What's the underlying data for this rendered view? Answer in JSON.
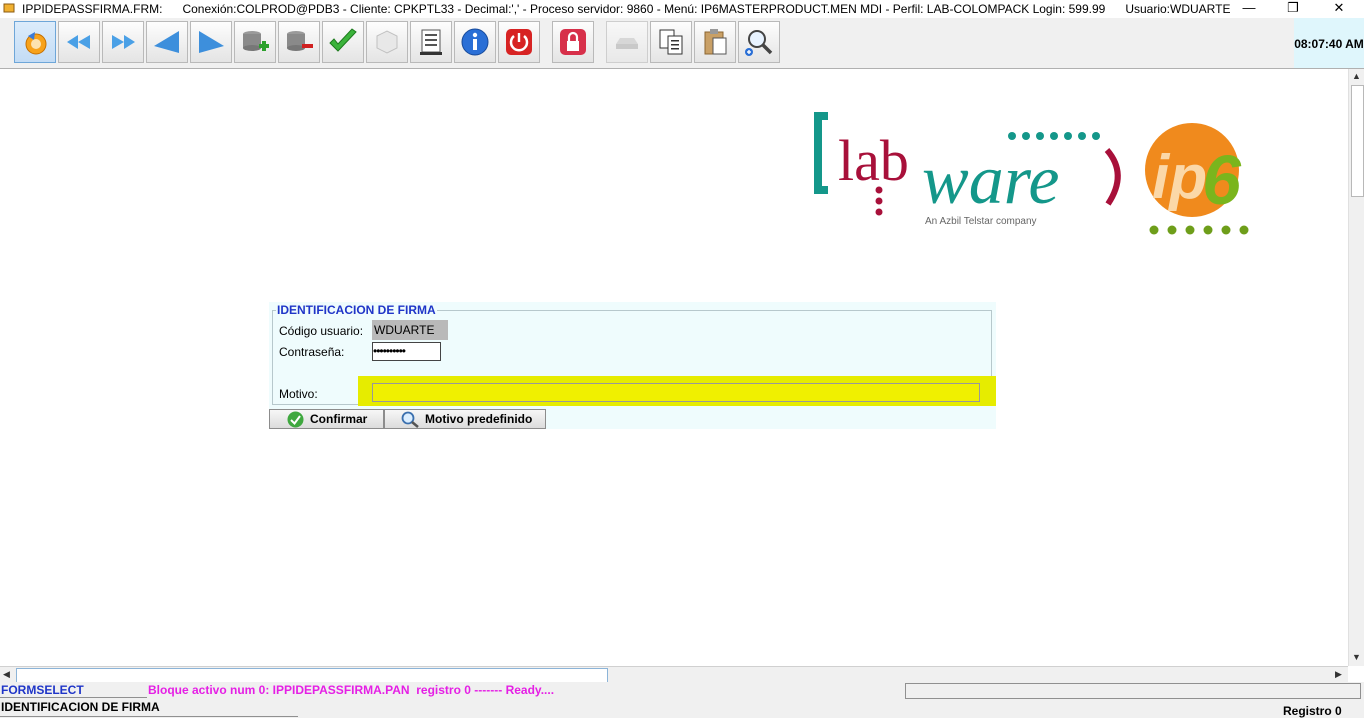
{
  "window": {
    "title": "IPPIDEPASSFIRMA.FRM:      Conexión:COLPROD@PDB3 - Cliente: CPKPTL33 - Decimal:',' - Proceso servidor: 9860 - Menú: IP6MASTERPRODUCT.MEN MDI - Perfil: LAB-COLOMPACK Login: 599.99      Usuario:WDUARTE",
    "minimize": "—",
    "maximize": "❐",
    "close": "✕"
  },
  "toolbar": {
    "clock": "08:07:40 AM",
    "buttons": [
      "undo-icon",
      "first-record-icon",
      "last-record-icon",
      "previous-record-icon",
      "next-record-icon",
      "insert-record-icon",
      "delete-record-icon",
      "commit-check-icon",
      "blank-box-icon",
      "list-document-icon",
      "info-icon",
      "power-exit-icon",
      "lock-icon",
      "disabled-tray-icon",
      "copy-icon",
      "paste-icon",
      "zoom-search-icon"
    ]
  },
  "logo": {
    "text_lab": "lab",
    "text_ware": "ware",
    "tagline": "An Azbil Telstar company",
    "ip": "ip",
    "six": "6"
  },
  "form": {
    "legend": "IDENTIFICACION DE FIRMA",
    "user_label": "Código usuario:",
    "user_value": "WDUARTE",
    "password_label": "Contraseña:",
    "password_value": "••••••••••",
    "motivo_label": "Motivo:",
    "motivo_value": "",
    "confirm_label": "Confirmar",
    "predef_label": "Motivo predefinido"
  },
  "status": {
    "form_name": "FORMSELECT",
    "message": "Bloque activo num 0: IPPIDEPASSFIRMA.PAN  registro 0 ------- Ready....",
    "form_title": "IDENTIFICACION DE FIRMA",
    "record": "Registro 0"
  },
  "colors": {
    "accent_blue": "#1f35c8",
    "status_magenta": "#e51fe5",
    "form_bg": "#effcfd",
    "highlight_yellow": "#e6ec00",
    "labware_teal": "#14978a",
    "labware_maroon": "#a8103a",
    "ip6_orange": "#f08a1d",
    "ip6_green": "#7ab51d"
  }
}
